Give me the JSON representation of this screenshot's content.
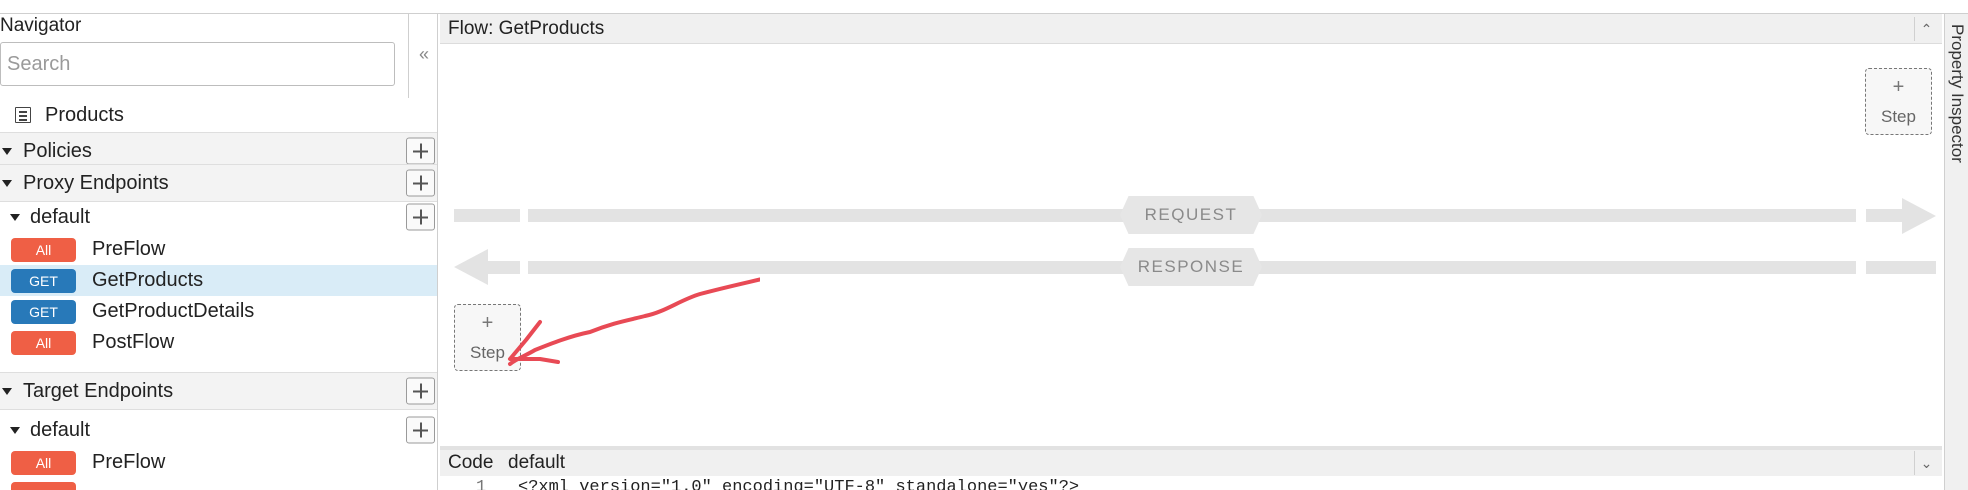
{
  "navigator": {
    "title": "Navigator",
    "collapse_icon": "«",
    "search_placeholder": "Search",
    "products_label": "Products",
    "sections": {
      "policies": "Policies",
      "proxy_endpoints": "Proxy Endpoints",
      "target_endpoints": "Target Endpoints"
    },
    "proxy_default": "default",
    "proxy_flows": [
      {
        "method": "All",
        "name": "PreFlow"
      },
      {
        "method": "GET",
        "name": "GetProducts"
      },
      {
        "method": "GET",
        "name": "GetProductDetails"
      },
      {
        "method": "All",
        "name": "PostFlow"
      }
    ],
    "target_default": "default",
    "target_flows": [
      {
        "method": "All",
        "name": "PreFlow"
      }
    ]
  },
  "flow": {
    "title": "Flow: GetProducts",
    "collapse_icon": "⌃",
    "step_plus": "+",
    "step_label": "Step",
    "request_label": "REQUEST",
    "response_label": "RESPONSE"
  },
  "property_inspector": {
    "label": "Property Inspector"
  },
  "code": {
    "tabs": [
      "Code",
      "default"
    ],
    "collapse_icon": "⌄",
    "line_number": "1",
    "line_text": "<?xml version=\"1.0\" encoding=\"UTF-8\" standalone=\"yes\"?>"
  },
  "colors": {
    "badge_all": "#ef5f45",
    "badge_get": "#2879b9",
    "selected_row": "#d9ecf7",
    "annotation_arrow": "#e84a55"
  }
}
